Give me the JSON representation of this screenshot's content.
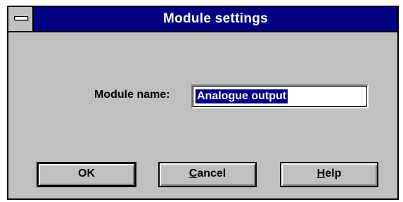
{
  "window": {
    "title": "Module settings"
  },
  "form": {
    "module_name_label": "Module name:",
    "module_name_value": "Analogue output"
  },
  "buttons": {
    "ok_label": "OK",
    "cancel_accel": "C",
    "cancel_rest": "ancel",
    "help_accel": "H",
    "help_rest": "elp"
  },
  "colors": {
    "titlebar": "#000080",
    "face": "#c0c0c0",
    "selection": "#000080"
  },
  "icons": {
    "system_menu": "system-menu-icon"
  }
}
